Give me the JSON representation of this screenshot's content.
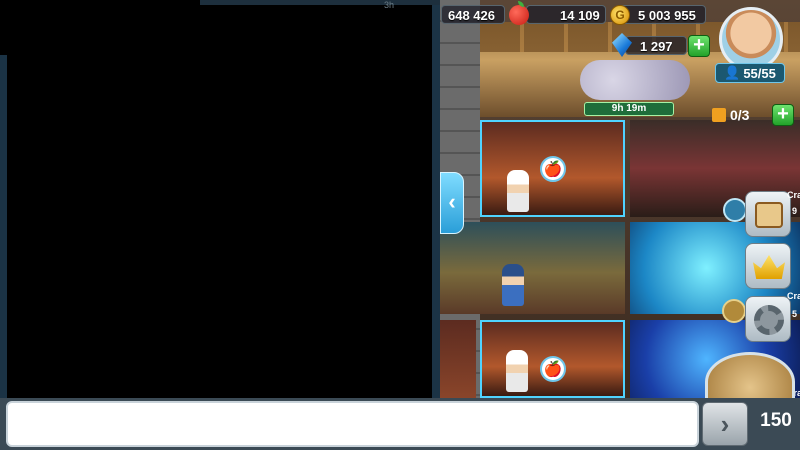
{
  "left_panel": {
    "corner_text": "3h"
  },
  "resources": {
    "population_counter": "648 426",
    "food": "14 109",
    "gold": "5 003 955",
    "gems": "1 297",
    "gold_symbol": "G",
    "plus_symbol": "+"
  },
  "population": {
    "value": "55/55"
  },
  "keys": {
    "value": "0/3"
  },
  "timer": {
    "text": "9h 19m"
  },
  "side_menu": {
    "craft_label_1": "Craft",
    "craft_sub_1": "9",
    "craft_label_2": "Craft",
    "craft_sub_2": "5",
    "craft_label_3": "Craft"
  },
  "navigation": {
    "back_arrow": "‹"
  },
  "chat": {
    "input_value": "",
    "input_placeholder": "",
    "send_symbol": "›",
    "char_count": "150"
  },
  "colors": {
    "accent": "#4fd3ff",
    "panel": "#1b3345",
    "plus_green": "#22a22a",
    "apple_red": "#c81b12",
    "coin_gold": "#d48b00"
  },
  "icons": [
    "apple-icon",
    "coin-icon",
    "gem-icon",
    "avatar",
    "lock-icon",
    "scroll-icon",
    "crown-icon",
    "gear-icon",
    "sword-badge",
    "shield-badge",
    "sack-icon"
  ]
}
